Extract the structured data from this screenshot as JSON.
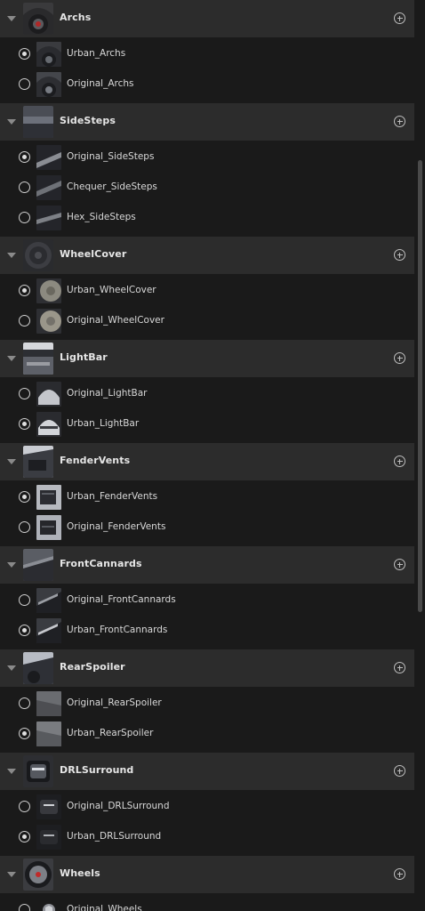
{
  "groups": [
    {
      "title": "Archs",
      "icon": "arch-thumbnail",
      "options": [
        {
          "label": "Urban_Archs",
          "selected": true,
          "icon": "arch-urban-thumbnail"
        },
        {
          "label": "Original_Archs",
          "selected": false,
          "icon": "arch-original-thumbnail"
        }
      ]
    },
    {
      "title": "SideSteps",
      "icon": "sidestep-thumbnail",
      "options": [
        {
          "label": "Original_SideSteps",
          "selected": true,
          "icon": "sidestep-original-thumbnail"
        },
        {
          "label": "Chequer_SideSteps",
          "selected": false,
          "icon": "sidestep-chequer-thumbnail"
        },
        {
          "label": "Hex_SideSteps",
          "selected": false,
          "icon": "sidestep-hex-thumbnail"
        }
      ]
    },
    {
      "title": "WheelCover",
      "icon": "wheelcover-thumbnail",
      "options": [
        {
          "label": "Urban_WheelCover",
          "selected": true,
          "icon": "wheelcover-urban-thumbnail"
        },
        {
          "label": "Original_WheelCover",
          "selected": false,
          "icon": "wheelcover-original-thumbnail"
        }
      ]
    },
    {
      "title": "LightBar",
      "icon": "lightbar-thumbnail",
      "options": [
        {
          "label": "Original_LightBar",
          "selected": false,
          "icon": "lightbar-original-thumbnail"
        },
        {
          "label": "Urban_LightBar",
          "selected": true,
          "icon": "lightbar-urban-thumbnail"
        }
      ]
    },
    {
      "title": "FenderVents",
      "icon": "fendervents-thumbnail",
      "options": [
        {
          "label": "Urban_FenderVents",
          "selected": true,
          "icon": "fendervents-urban-thumbnail"
        },
        {
          "label": "Original_FenderVents",
          "selected": false,
          "icon": "fendervents-original-thumbnail"
        }
      ]
    },
    {
      "title": "FrontCannards",
      "icon": "frontcannards-thumbnail",
      "options": [
        {
          "label": "Original_FrontCannards",
          "selected": false,
          "icon": "frontcannards-original-thumbnail"
        },
        {
          "label": "Urban_FrontCannards",
          "selected": true,
          "icon": "frontcannards-urban-thumbnail"
        }
      ]
    },
    {
      "title": "RearSpoiler",
      "icon": "rearspoiler-thumbnail",
      "options": [
        {
          "label": "Original_RearSpoiler",
          "selected": false,
          "icon": "rearspoiler-original-thumbnail"
        },
        {
          "label": "Urban_RearSpoiler",
          "selected": true,
          "icon": "rearspoiler-urban-thumbnail"
        }
      ]
    },
    {
      "title": "DRLSurround",
      "icon": "drlsurround-thumbnail",
      "options": [
        {
          "label": "Original_DRLSurround",
          "selected": false,
          "icon": "drlsurround-original-thumbnail"
        },
        {
          "label": "Urban_DRLSurround",
          "selected": true,
          "icon": "drlsurround-urban-thumbnail"
        }
      ]
    },
    {
      "title": "Wheels",
      "icon": "wheels-thumbnail",
      "options": [
        {
          "label": "Original_Wheels",
          "selected": false,
          "icon": "wheels-original-thumbnail"
        }
      ]
    }
  ],
  "colors": {
    "background": "#1a1a1a",
    "header_background": "#2c2c2c",
    "text": "#d8d8d8",
    "header_text": "#e6e6e6",
    "scrollbar": "#4a4a4a"
  }
}
